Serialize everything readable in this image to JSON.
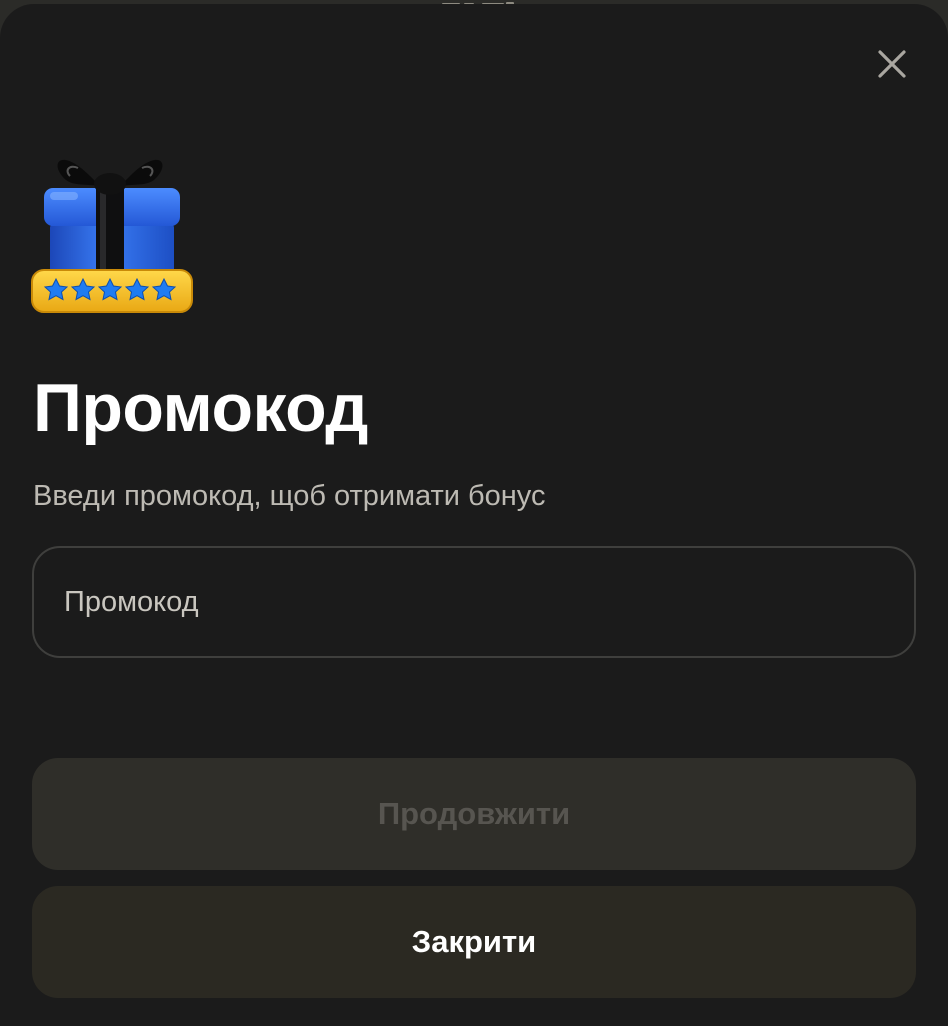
{
  "dialog": {
    "title": "Промокод",
    "subtitle": "Введи промокод, щоб отримати бонус",
    "promo_field": {
      "placeholder": "Промокод",
      "value": ""
    },
    "continue_label": "Продовжити",
    "continue_disabled": true,
    "close_label": "Закрити",
    "close_icon": "close-icon",
    "gift_icon": "gift-box-icon"
  },
  "colors": {
    "dialog_background": "#1b1b1b",
    "title_text": "#ffffff",
    "subtitle_text": "#bdbab3",
    "input_border": "#3f3f3d",
    "button_background": "#2f2d27",
    "disabled_button_text": "#575550",
    "gift_blue": "#2f6fe8",
    "gift_ribbon": "#111111",
    "rating_badge_yellow": "#f5c532",
    "rating_star_blue": "#1f7cf2"
  },
  "rating_badge": {
    "star_count": 5
  }
}
